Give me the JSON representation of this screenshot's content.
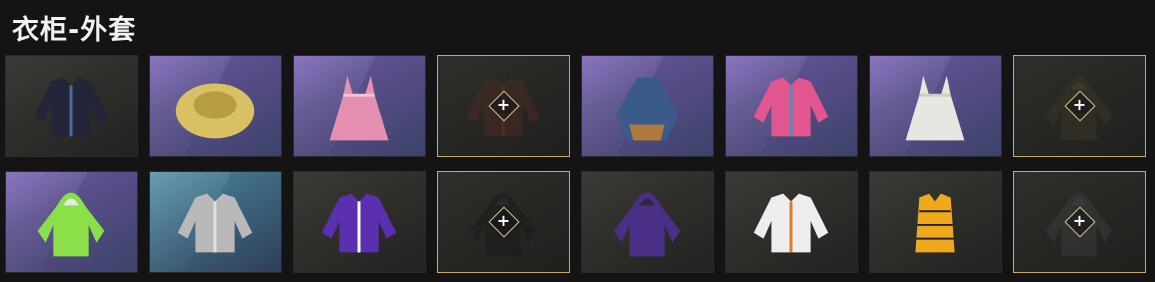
{
  "header": {
    "title": "衣柜-外套"
  },
  "slots": [
    {
      "name": "outfit-slot-dark-sweater",
      "bg": "dark",
      "icon": "sweater-icon",
      "color": "#222638",
      "accent": "#4b6b9a",
      "empty": false
    },
    {
      "name": "outfit-slot-yellow-fur-jacket",
      "bg": "purple",
      "icon": "fur-jacket-icon",
      "color": "#d9c062",
      "accent": "#b89d45",
      "empty": false
    },
    {
      "name": "outfit-slot-pink-dress-coat",
      "bg": "purple",
      "icon": "dress-coat-icon",
      "color": "#e58fb3",
      "accent": "#f4c3d6",
      "empty": false
    },
    {
      "name": "outfit-slot-empty-1",
      "bg": "empty",
      "icon": "brown-jacket-icon",
      "color": "#4a2a22",
      "accent": "#6b3a2e",
      "empty": true
    },
    {
      "name": "outfit-slot-blue-poncho",
      "bg": "purple",
      "icon": "poncho-icon",
      "color": "#3a5a8a",
      "accent": "#b07a3a",
      "empty": false
    },
    {
      "name": "outfit-slot-pink-crop-top",
      "bg": "purple",
      "icon": "crop-top-icon",
      "color": "#e2568f",
      "accent": "#4b8fb5",
      "empty": false
    },
    {
      "name": "outfit-slot-white-dress",
      "bg": "purple",
      "icon": "dress-icon",
      "color": "#e8e6e1",
      "accent": "#cfcac2",
      "empty": false
    },
    {
      "name": "outfit-slot-empty-2",
      "bg": "empty",
      "icon": "hooded-cloak-icon",
      "color": "#3a3626",
      "accent": "#4d4832",
      "empty": true
    },
    {
      "name": "outfit-slot-green-hoodie",
      "bg": "purple",
      "icon": "hoodie-icon",
      "color": "#8be04a",
      "accent": "#e8e8e8",
      "empty": false
    },
    {
      "name": "outfit-slot-silver-jacket",
      "bg": "teal",
      "icon": "silver-jacket-icon",
      "color": "#b9b9b9",
      "accent": "#e0e0e0",
      "empty": false
    },
    {
      "name": "outfit-slot-purple-track-jacket",
      "bg": "dark",
      "icon": "track-jacket-icon",
      "color": "#5a2fb0",
      "accent": "#ffffff",
      "empty": false
    },
    {
      "name": "outfit-slot-empty-3",
      "bg": "empty",
      "icon": "black-hoodie-icon",
      "color": "#1b1b1b",
      "accent": "#2c2c2c",
      "empty": true
    },
    {
      "name": "outfit-slot-purple-camo-anorak",
      "bg": "dark",
      "icon": "anorak-icon",
      "color": "#4a2f86",
      "accent": "#2a2a3a",
      "empty": false
    },
    {
      "name": "outfit-slot-orange-white-jacket",
      "bg": "dark",
      "icon": "racing-jacket-icon",
      "color": "#eeeeee",
      "accent": "#e0782a",
      "empty": false
    },
    {
      "name": "outfit-slot-yellow-puffer-vest",
      "bg": "dark",
      "icon": "puffer-vest-icon",
      "color": "#f0a81c",
      "accent": "#222222",
      "empty": false
    },
    {
      "name": "outfit-slot-empty-4",
      "bg": "empty",
      "icon": "grey-hoodie-icon",
      "color": "#3b3b3b",
      "accent": "#4a4a4a",
      "empty": true
    }
  ],
  "plus_label": "+"
}
